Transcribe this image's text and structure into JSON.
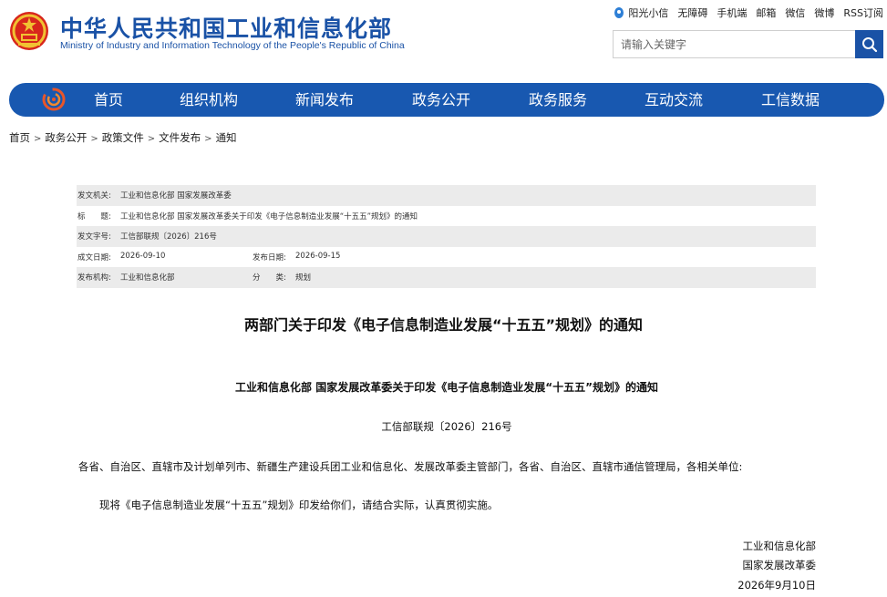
{
  "header": {
    "title": "中华人民共和国工业和信息化部",
    "subtitle": "Ministry of Industry and Information Technology of the People's Republic of China",
    "top_links": [
      "阳光小信",
      "无障碍",
      "手机端",
      "邮箱",
      "微信",
      "微博",
      "RSS订阅"
    ],
    "search_placeholder": "请输入关键字"
  },
  "nav": {
    "items": [
      "首页",
      "组织机构",
      "新闻发布",
      "政务公开",
      "政务服务",
      "互动交流",
      "工信数据"
    ],
    "color": "#1858b0"
  },
  "breadcrumb": [
    "首页",
    "政务公开",
    "政策文件",
    "文件发布",
    "通知"
  ],
  "meta": {
    "issuer_label": "发文机关:",
    "issuer": "工业和信息化部 国家发展改革委",
    "title_label": "标　　题:",
    "title": "工业和信息化部 国家发展改革委关于印发《电子信息制造业发展“十五五”规划》的通知",
    "doc_no_label": "发文字号:",
    "doc_no": "工信部联规〔2026〕216号",
    "created_label": "成文日期:",
    "created": "2026-09-10",
    "published_label": "发布日期:",
    "published": "2026-09-15",
    "agency_label": "发布机构:",
    "agency": "工业和信息化部",
    "category_label": "分　　类:",
    "category": "规划"
  },
  "article": {
    "title": "两部门关于印发《电子信息制造业发展“十五五”规划》的通知",
    "doc_head": "工业和信息化部  国家发展改革委关于印发《电子信息制造业发展“十五五”规划》的通知",
    "doc_no": "工信部联规〔2026〕216号",
    "addressee": "各省、自治区、直辖市及计划单列市、新疆生产建设兵团工业和信息化、发展改革委主管部门，各省、自治区、直辖市通信管理局，各相关单位:",
    "body": "现将《电子信息制造业发展“十五五”规划》印发给你们，请结合实际，认真贯彻实施。",
    "sign_1": "工业和信息化部",
    "sign_2": "国家发展改革委",
    "sign_date": "2026年9月10日"
  }
}
